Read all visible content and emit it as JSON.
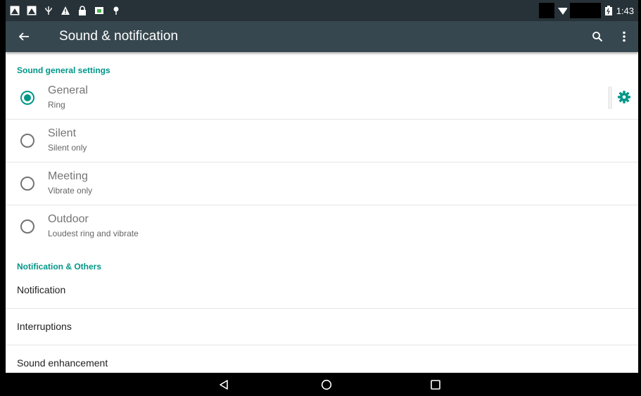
{
  "status_bar": {
    "time": "1:43",
    "left_icons": [
      "image-icon",
      "image-icon",
      "usb-icon",
      "warning-icon",
      "lock-icon",
      "android-icon",
      "pin-icon"
    ],
    "right_icons": [
      "wifi-icon",
      "battery-icon"
    ]
  },
  "app_bar": {
    "title": "Sound & notification",
    "back_icon": "arrow-back-icon",
    "search_icon": "search-icon",
    "more_icon": "more-vert-icon"
  },
  "sections": {
    "general_header": "Sound general settings",
    "notification_header": "Notification & Others"
  },
  "profiles": [
    {
      "title": "General",
      "subtitle": "Ring",
      "checked": true,
      "has_settings": true
    },
    {
      "title": "Silent",
      "subtitle": "Silent only",
      "checked": false
    },
    {
      "title": "Meeting",
      "subtitle": "Vibrate only",
      "checked": false
    },
    {
      "title": "Outdoor",
      "subtitle": "Loudest ring and vibrate",
      "checked": false
    }
  ],
  "items": [
    {
      "label": "Notification"
    },
    {
      "label": "Interruptions"
    },
    {
      "label": "Sound enhancement"
    }
  ],
  "nav_bar": {
    "back_icon": "nav-back-icon",
    "home_icon": "nav-home-icon",
    "recents_icon": "nav-recents-icon"
  },
  "colors": {
    "accent": "#009688",
    "app_bar": "#37474f",
    "status_bar": "#263238"
  }
}
